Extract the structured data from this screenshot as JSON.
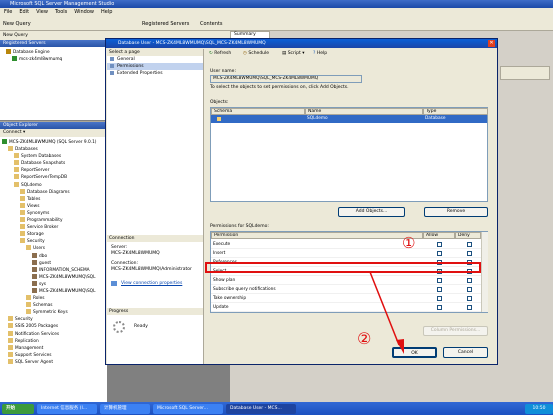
{
  "app": {
    "title": "Microsoft SQL Server Management Studio"
  },
  "menu": [
    "File",
    "Edit",
    "View",
    "Tools",
    "Window",
    "Help"
  ],
  "toolbar": {
    "new_query": "New Query",
    "registered_servers": "Registered Servers",
    "contents": "Contents",
    "summary_tab": "Summary"
  },
  "toolbar2": {
    "new_query": "New Query"
  },
  "registered": {
    "header": "Registered Servers",
    "items": [
      "Database Engine",
      "mcs-zk4ml8wmumq"
    ]
  },
  "explorer": {
    "header": "Object Explorer",
    "connect": "Connect ▾",
    "tree": [
      "MCS-ZK4ML8WMUMQ (SQL Server 9.0.1)",
      "Databases",
      "System Databases",
      "Database Snapshots",
      "ReportServer",
      "ReportServerTempDB",
      "SQLdemo",
      "Database Diagrams",
      "Tables",
      "Views",
      "Synonyms",
      "Programmability",
      "Service Broker",
      "Storage",
      "Security",
      "Users",
      "dbo",
      "guest",
      "INFORMATION_SCHEMA",
      "MCS-ZK4ML8WMUMQ\\SQL",
      "sys",
      "MCS-ZK4ML8WMUMQ\\SQL",
      "Roles",
      "Schemas",
      "Symmetric Keys",
      "Security",
      "Server Objects",
      "Replication",
      "Management",
      "Notification Services",
      "SQL Server Agent"
    ],
    "tree2": [
      "Security",
      "SSIS 2005 Packages",
      "Notification Services",
      "Replication",
      "Management",
      "Support Services",
      "SQL Server Agent"
    ]
  },
  "dialog": {
    "title": "Database User - MCS-ZK4ML8WMUMQ\\SQL_MCS-ZK4ML8WMUMQ",
    "select_page": "Select a page",
    "pages": [
      "General",
      "Permissions",
      "Extended Properties"
    ],
    "refresh": "Refresh",
    "schedule": "Schedule",
    "script": "Script",
    "help": "Help",
    "connection_header": "Connection",
    "server_label": "Server:",
    "server_value": "MCS-ZK4ML8WMUMQ",
    "connection_label": "Connection:",
    "connection_value": "MCS-ZK4ML8WMUMQ\\Administrator",
    "view_conn": "View connection properties",
    "progress_header": "Progress",
    "progress_status": "Ready",
    "user_name_label": "User name:",
    "user_name_value": "MCS-ZK4ML8WMUMQ\\SQL_MCS-ZK4ML8WMUMQ",
    "instruction": "To select the objects to set permissions on, click Add Objects.",
    "objects_label": "Objects:",
    "obj_headers": [
      "Schema",
      "Name",
      "Type"
    ],
    "obj_rows": [
      {
        "schema": "",
        "name": "SQLdemo",
        "type": "Database"
      }
    ],
    "add_objects": "Add Objects...",
    "remove": "Remove",
    "perm_label": "Permissions for SQLdemo:",
    "perm_headers": [
      "Permission",
      "Allow",
      "Deny"
    ],
    "perm_rows": [
      {
        "name": "Execute",
        "allow": false,
        "deny": false
      },
      {
        "name": "Insert",
        "allow": false,
        "deny": false
      },
      {
        "name": "References",
        "allow": false,
        "deny": false
      },
      {
        "name": "Select",
        "allow": true,
        "deny": false
      },
      {
        "name": "Show plan",
        "allow": false,
        "deny": false
      },
      {
        "name": "Subscribe query notifications",
        "allow": false,
        "deny": false
      },
      {
        "name": "Take ownership",
        "allow": false,
        "deny": false
      },
      {
        "name": "Update",
        "allow": false,
        "deny": false
      }
    ],
    "column_permissions": "Column Permissions...",
    "ok": "OK",
    "cancel": "Cancel"
  },
  "callouts": {
    "one": "①",
    "two": "②"
  },
  "taskbar": {
    "start": "开始",
    "items": [
      "Internet 信息服务 (I...",
      "计算机管理",
      "Microsoft SQL Server...",
      "Database User - MCS..."
    ],
    "clock": "10:50"
  },
  "colors": {
    "highlight": "#e01010",
    "selection": "#c1d2ee",
    "title": "#1c4aa8"
  }
}
